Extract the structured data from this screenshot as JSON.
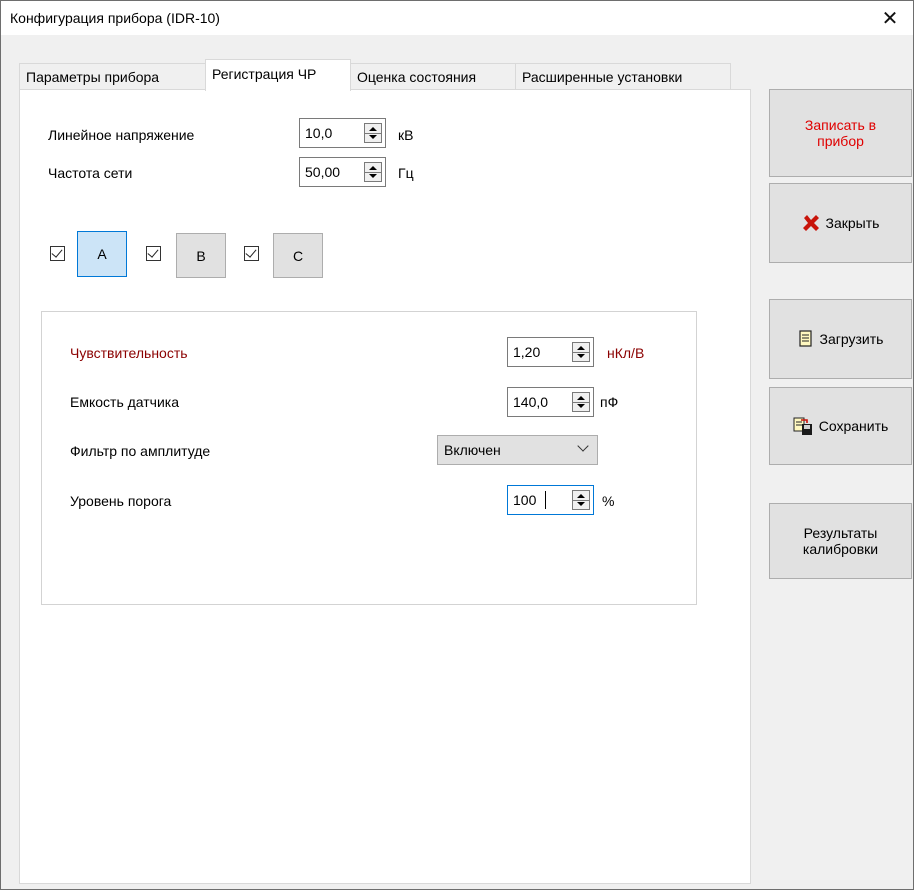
{
  "window": {
    "title": "Конфигурация прибора (IDR-10)",
    "close_glyph": "✕"
  },
  "tabs": [
    {
      "label": "Параметры прибора",
      "active": false
    },
    {
      "label": "Регистрация ЧР",
      "active": true
    },
    {
      "label": "Оценка состояния",
      "active": false
    },
    {
      "label": "Расширенные установки",
      "active": false
    }
  ],
  "general": {
    "line_voltage": {
      "label": "Линейное напряжение",
      "value": "10,0",
      "unit": "кВ"
    },
    "frequency": {
      "label": "Частота сети",
      "value": "50,00",
      "unit": "Гц"
    }
  },
  "phases": [
    {
      "label": "A",
      "checked": true,
      "selected": true
    },
    {
      "label": "B",
      "checked": true,
      "selected": false
    },
    {
      "label": "C",
      "checked": true,
      "selected": false
    }
  ],
  "phase_settings": {
    "sensitivity": {
      "label": "Чувствительность",
      "value": "1,20",
      "unit": "нКл/В",
      "color": "#8b0000"
    },
    "capacity": {
      "label": "Емкость датчика",
      "value": "140,0",
      "unit": "пФ"
    },
    "amp_filter": {
      "label": "Фильтр по амплитуде",
      "value": "Включен"
    },
    "threshold": {
      "label": "Уровень порога",
      "value": "100",
      "unit": "%"
    }
  },
  "buttons": {
    "write": {
      "label": "Записать в прибор",
      "color": "#e00000"
    },
    "close": {
      "label": "Закрыть",
      "icon": "x-icon"
    },
    "load": {
      "label": "Загрузить",
      "icon": "document-icon"
    },
    "save": {
      "label": "Сохранить",
      "icon": "save-icon"
    },
    "calibration": {
      "label": "Результаты калибровки"
    }
  }
}
